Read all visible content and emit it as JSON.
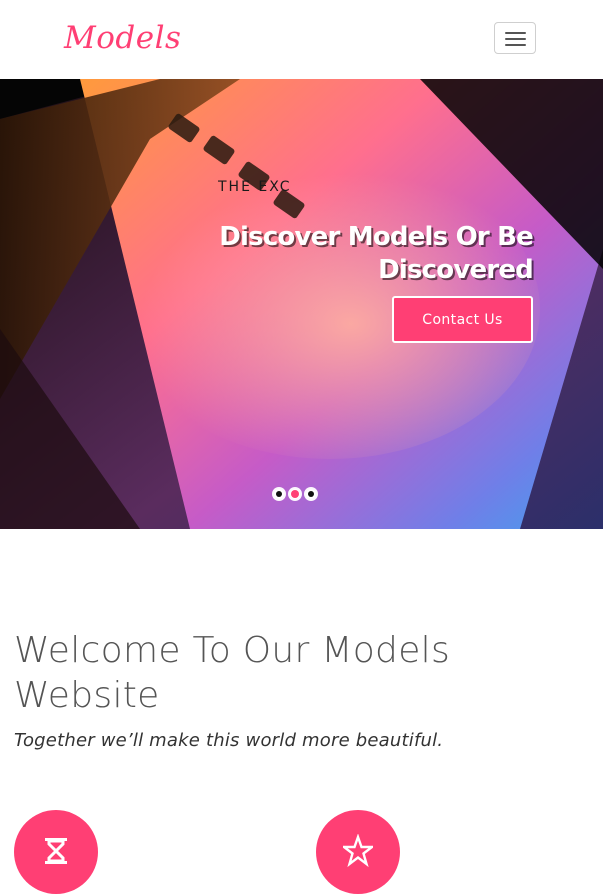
{
  "brand": {
    "logo_text": "Models",
    "logo_color": "#ff3f74"
  },
  "nav": {
    "toggler_icon": "hamburger-icon"
  },
  "hero": {
    "kicker": "THE EXCLUSIVE",
    "heading": "Discover Models Or Be Discovered",
    "cta_label": "Contact Us",
    "accent": "#ff3f74",
    "slides_count": 3,
    "active_slide": 2
  },
  "welcome": {
    "title": "Welcome To Our Models Website",
    "subtitle": "Together we’ll make this world more beautiful."
  },
  "features": [
    {
      "icon": "hourglass-icon"
    },
    {
      "icon": "star-icon"
    }
  ]
}
